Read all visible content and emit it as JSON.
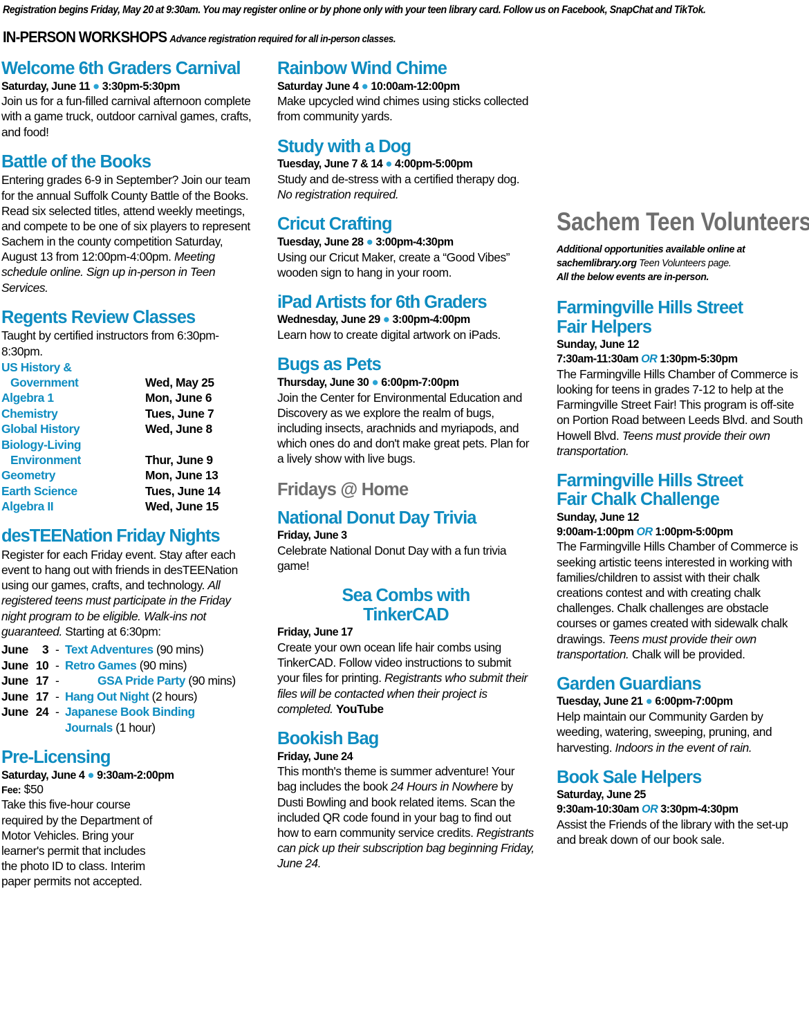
{
  "colors": {
    "accent": "#0e8cc0",
    "gray": "#6e6e6e",
    "dot": "#29a3d4",
    "text": "#000000"
  },
  "header": {
    "registration_line": "Registration begins Friday, May 20 at 9:30am. You may register online or by phone only with your teen library card. Follow us on Facebook, SnapChat and TikTok.",
    "section_title": "IN-PERSON WORKSHOPS",
    "section_subtitle": "Advance registration required for all in-person classes."
  },
  "left_column": {
    "carnival": {
      "title": "Welcome 6th Graders Carnival",
      "when_date": "Saturday, June 11",
      "when_time": "3:30pm-5:30pm",
      "body": "Join us for a fun-filled carnival afternoon complete with a game truck, outdoor carnival games, crafts, and food!"
    },
    "battle": {
      "title": "Battle of the Books",
      "body_plain": "Entering grades 6-9 in September? Join our team for the annual Suffolk County Battle of the Books. Read six selected titles, attend weekly meetings, and compete to be one of six players to represent Sachem in the county competition Saturday, August 13 from 12:00pm-4:00pm.",
      "body_italic": "Meeting schedule online. Sign up in-person in Teen Services."
    },
    "regents": {
      "title": "Regents Review Classes",
      "intro": "Taught by certified instructors from 6:30pm-8:30pm.",
      "rows": [
        {
          "subject_line1": "US History &",
          "subject_line2": "Government",
          "date": "Wed, May 25"
        },
        {
          "subject_line1": "Algebra 1",
          "date": "Mon, June 6"
        },
        {
          "subject_line1": "Chemistry",
          "date": "Tues, June 7"
        },
        {
          "subject_line1": "Global History",
          "date": "Wed, June 8"
        },
        {
          "subject_line1": "Biology-Living",
          "subject_line2": "Environment",
          "date": "Thur, June 9"
        },
        {
          "subject_line1": "Geometry",
          "date": "Mon, June 13"
        },
        {
          "subject_line1": "Earth Science",
          "date": "Tues, June 14"
        },
        {
          "subject_line1": "Algebra II",
          "date": "Wed, June 15"
        }
      ]
    },
    "desteenation": {
      "title": "desTEENation Friday Nights",
      "body_plain_1": "Register for each Friday event. Stay after each event to hang out with friends in desTEENation using our games, crafts, and technology.",
      "body_italic": "All registered teens must participate in the Friday night program to be eligible. Walk-ins not guaranteed.",
      "body_plain_2": "Starting at 6:30pm:",
      "events": [
        {
          "month": "June",
          "day": "3",
          "name": "Text Adventures",
          "duration": "(90 mins)",
          "pushed": false
        },
        {
          "month": "June",
          "day": "10",
          "name": "Retro Games",
          "duration": "(90 mins)",
          "pushed": false
        },
        {
          "month": "June",
          "day": "17",
          "name": "GSA Pride Party",
          "duration": "(90 mins)",
          "pushed": true
        },
        {
          "month": "June",
          "day": "17",
          "name": "Hang Out Night",
          "duration": "(2 hours)",
          "pushed": false
        },
        {
          "month": "June",
          "day": "24",
          "name": "Japanese Book Binding",
          "name_cont": "Journals",
          "duration": "(1 hour)",
          "pushed": false
        }
      ]
    },
    "prelicensing": {
      "title": "Pre-Licensing",
      "when_date": "Saturday, June 4",
      "when_time": "9:30am-2:00pm",
      "fee_label": "Fee:",
      "fee_amount": "$50",
      "body": "Take this five-hour course required by the Department of Motor Vehicles. Bring your learner's permit that includes the photo ID to class. Interim paper permits not accepted."
    }
  },
  "middle_column": {
    "wind_chime": {
      "title": "Rainbow Wind Chime",
      "when_date": "Saturday June 4",
      "when_time": "10:00am-12:00pm",
      "body": "Make upcycled wind chimes using sticks collected from community yards."
    },
    "study_dog": {
      "title": "Study with a Dog",
      "when_date": "Tuesday, June 7 & 14",
      "when_time": "4:00pm-5:00pm",
      "body_plain": "Study and de-stress with a certified therapy dog.",
      "body_italic": "No registration required."
    },
    "cricut": {
      "title": "Cricut Crafting",
      "when_date": "Tuesday, June 28",
      "when_time": "3:00pm-4:30pm",
      "body": "Using our Cricut Maker, create a “Good Vibes” wooden sign to hang in your room."
    },
    "ipad": {
      "title": "iPad Artists for 6th Graders",
      "when_date": "Wednesday, June 29",
      "when_time": "3:00pm-4:00pm",
      "body": "Learn how to create digital artwork on iPads."
    },
    "bugs": {
      "title": "Bugs as Pets",
      "when_date": "Thursday, June 30",
      "when_time": "6:00pm-7:00pm",
      "body": "Join the Center for Environmental Education and Discovery as we explore the realm of bugs, including insects, arachnids and myriapods, and which ones do and don't make great pets. Plan for a lively show with live bugs."
    },
    "fridays_section_title": "Fridays @ Home",
    "donut": {
      "title": "National Donut Day Trivia",
      "when_date": "Friday, June 3",
      "body": "Celebrate National Donut Day with a fun trivia game!"
    },
    "sea_combs": {
      "title_line1": "Sea Combs with",
      "title_line2": "TinkerCAD",
      "when_date": "Friday, June 17",
      "body_plain": "Create your own ocean life hair combs using TinkerCAD. Follow video instructions to submit your files for printing.",
      "body_italic": "Registrants who submit their files will be contacted when their project is completed.",
      "body_bold": "YouTube"
    },
    "bookish_bag": {
      "title": "Bookish Bag",
      "when_date": "Friday, June 24",
      "body_part1": "This month's theme is summer adventure! Your bag includes the book ",
      "body_book_title": "24 Hours in Nowhere",
      "body_part2": " by Dusti Bowling and book related items. Scan the included QR code found in your bag to find out how to earn community service credits. ",
      "body_italic": "Registrants can pick up their subscription bag beginning Friday, June 24."
    }
  },
  "right_column": {
    "header_title": "Sachem Teen Volunteers",
    "note_line1_italic": "Additional opportunities available online at",
    "note_line2_bold": "sachemlibrary.org",
    "note_line2_rest": " Teen Volunteers page.",
    "note_line3": "All the below events are in-person.",
    "events": [
      {
        "title_line1": "Farmingville Hills Street",
        "title_line2": "Fair Helpers",
        "when_date": "Sunday, June 12",
        "time_a": "7:30am-11:30am",
        "or_label": "OR",
        "time_b": "1:30pm-5:30pm",
        "body_plain": "The Farmingville Hills Chamber of Commerce is looking for teens in grades 7-12 to help at the Farmingville Street Fair! This program is off-site on Portion Road between Leeds Blvd. and South Howell Blvd.",
        "body_italic": "Teens must provide their own transportation."
      },
      {
        "title_line1": "Farmingville Hills Street",
        "title_line2": "Fair Chalk Challenge",
        "when_date": "Sunday, June 12",
        "time_a": "9:00am-1:00pm",
        "or_label": "OR",
        "time_b": "1:00pm-5:00pm",
        "body_plain": "The Farmingville Hills Chamber of Commerce is seeking artistic teens interested in working with families/children to assist with their chalk creations contest and with creating chalk challenges. Chalk challenges are obstacle courses or games created with sidewalk chalk drawings.",
        "body_italic": "Teens must provide their own transportation.",
        "body_plain_end": "Chalk will be provided."
      },
      {
        "title_line1": "Garden Guardians",
        "when_date": "Tuesday, June 21",
        "when_time": "6:00pm-7:00pm",
        "body_plain": "Help maintain our Community Garden by weeding, watering, sweeping, pruning, and harvesting.",
        "body_italic": "Indoors in the event of rain."
      },
      {
        "title_line1": "Book Sale Helpers",
        "when_date": "Saturday, June 25",
        "time_a": "9:30am-10:30am",
        "or_label": "OR",
        "time_b": "3:30pm-4:30pm",
        "body_plain": "Assist the Friends of the library with the set-up and break down of our book sale."
      }
    ]
  }
}
